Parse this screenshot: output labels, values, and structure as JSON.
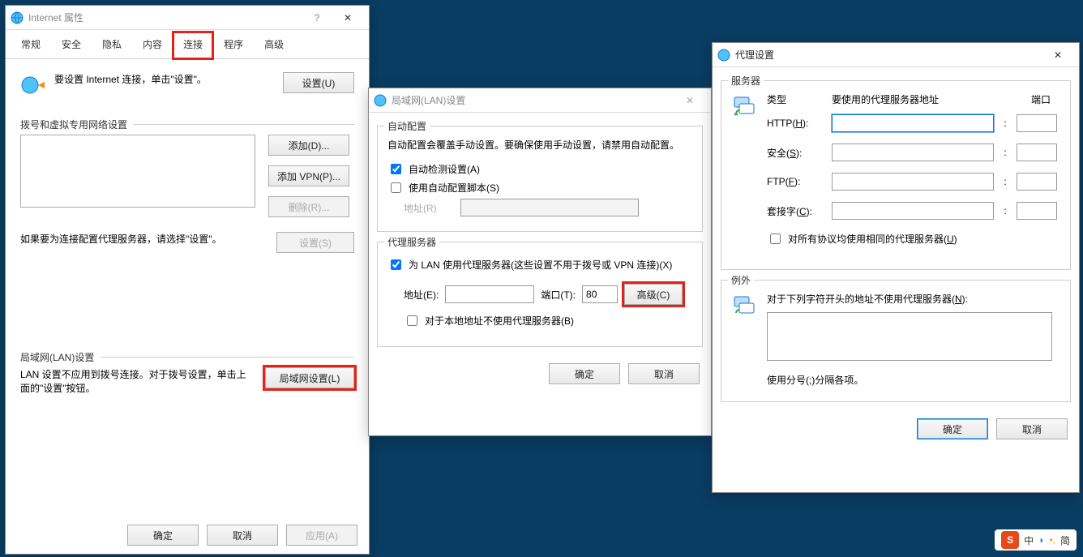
{
  "desktop": {
    "bg": "#0a3d62"
  },
  "internet_props": {
    "title": "Internet 属性",
    "tabs": [
      "常规",
      "安全",
      "隐私",
      "内容",
      "连接",
      "程序",
      "高级"
    ],
    "active_tab_index": 4,
    "highlight_tab_index": 4,
    "setup_text": "要设置 Internet 连接，单击\"设置\"。",
    "btn_setup": "设置(U)",
    "section_dialup": "拨号和虚拟专用网络设置",
    "btn_add": "添加(D)...",
    "btn_add_vpn": "添加 VPN(P)...",
    "btn_remove": "删除(R)...",
    "btn_settings2": "设置(S)",
    "proxy_hint": "如果要为连接配置代理服务器，请选择\"设置\"。",
    "section_lan": "局域网(LAN)设置",
    "lan_hint": "LAN 设置不应用到拨号连接。对于拨号设置，单击上面的\"设置\"按钮。",
    "btn_lan": "局域网设置(L)",
    "btn_ok": "确定",
    "btn_cancel": "取消",
    "btn_apply": "应用(A)"
  },
  "lan_settings": {
    "title": "局域网(LAN)设置",
    "group_auto": "自动配置",
    "auto_hint": "自动配置会覆盖手动设置。要确保使用手动设置，请禁用自动配置。",
    "cb_auto_detect": "自动检测设置(A)",
    "cb_auto_detect_checked": true,
    "cb_use_script": "使用自动配置脚本(S)",
    "cb_use_script_checked": false,
    "addr_label": "地址(R)",
    "addr_value": "",
    "group_proxy": "代理服务器",
    "cb_use_proxy": "为 LAN 使用代理服务器(这些设置不用于拨号或 VPN 连接)(X)",
    "cb_use_proxy_checked": true,
    "proxy_addr_label": "地址(E):",
    "proxy_addr_value": "",
    "proxy_port_label": "端口(T):",
    "proxy_port_value": "80",
    "btn_advanced": "高级(C)",
    "cb_bypass_local": "对于本地地址不使用代理服务器(B)",
    "cb_bypass_local_checked": false,
    "btn_ok": "确定",
    "btn_cancel": "取消"
  },
  "proxy_settings": {
    "title": "代理设置",
    "group_servers": "服务器",
    "col_type": "类型",
    "col_addr": "要使用的代理服务器地址",
    "col_port": "端口",
    "rows": {
      "http_label": "HTTP(H):",
      "http_addr": "",
      "http_port": "",
      "secure_label": "安全(S):",
      "secure_addr": "",
      "secure_port": "",
      "ftp_label": "FTP(F):",
      "ftp_addr": "",
      "ftp_port": "",
      "socks_label": "套接字(C):",
      "socks_addr": "",
      "socks_port": ""
    },
    "cb_same_all": "对所有协议均使用相同的代理服务器(U)",
    "cb_same_all_checked": false,
    "group_exceptions": "例外",
    "exceptions_label": "对于下列字符开头的地址不使用代理服务器(N):",
    "exceptions_value": "",
    "exceptions_hint": "使用分号(;)分隔各项。",
    "btn_ok": "确定",
    "btn_cancel": "取消"
  },
  "tray": {
    "sogou_mid": "中",
    "sogou_end": "简"
  }
}
